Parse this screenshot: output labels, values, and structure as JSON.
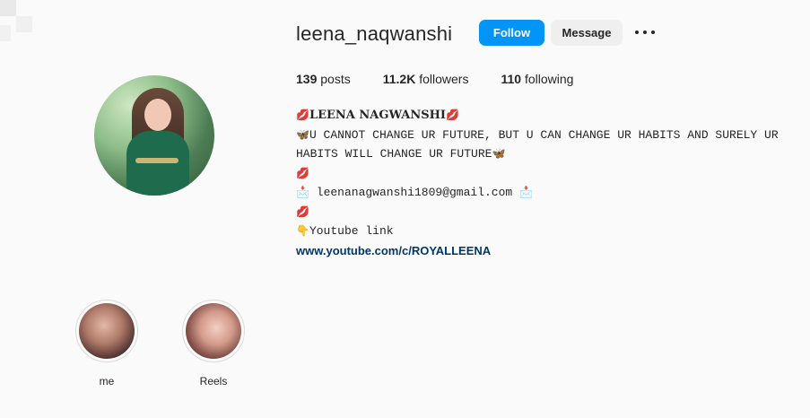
{
  "header": {
    "username": "leena_naqwanshi",
    "follow_label": "Follow",
    "message_label": "Message",
    "more_icon": "more-options-icon"
  },
  "stats": {
    "posts_count": "139",
    "posts_label": "posts",
    "followers_count": "11.2K",
    "followers_label": "followers",
    "following_count": "110",
    "following_label": "following"
  },
  "bio": {
    "name": "LEENA NAGWANSHI",
    "line1": "U CANNOT CHANGE UR FUTURE, BUT U CAN CHANGE UR HABITS AND SURELY UR",
    "line2": "HABITS WILL CHANGE UR FUTURE",
    "email": "leenanagwanshi1809@gmail.com",
    "youtube_label": "Youtube link",
    "link": "www.youtube.com/c/ROYALLEENA"
  },
  "highlights": [
    {
      "label": "me"
    },
    {
      "label": "Reels"
    }
  ],
  "colors": {
    "follow_button": "#0095f6",
    "message_button": "#efefef",
    "link": "#00376b",
    "background": "#fafafa"
  }
}
